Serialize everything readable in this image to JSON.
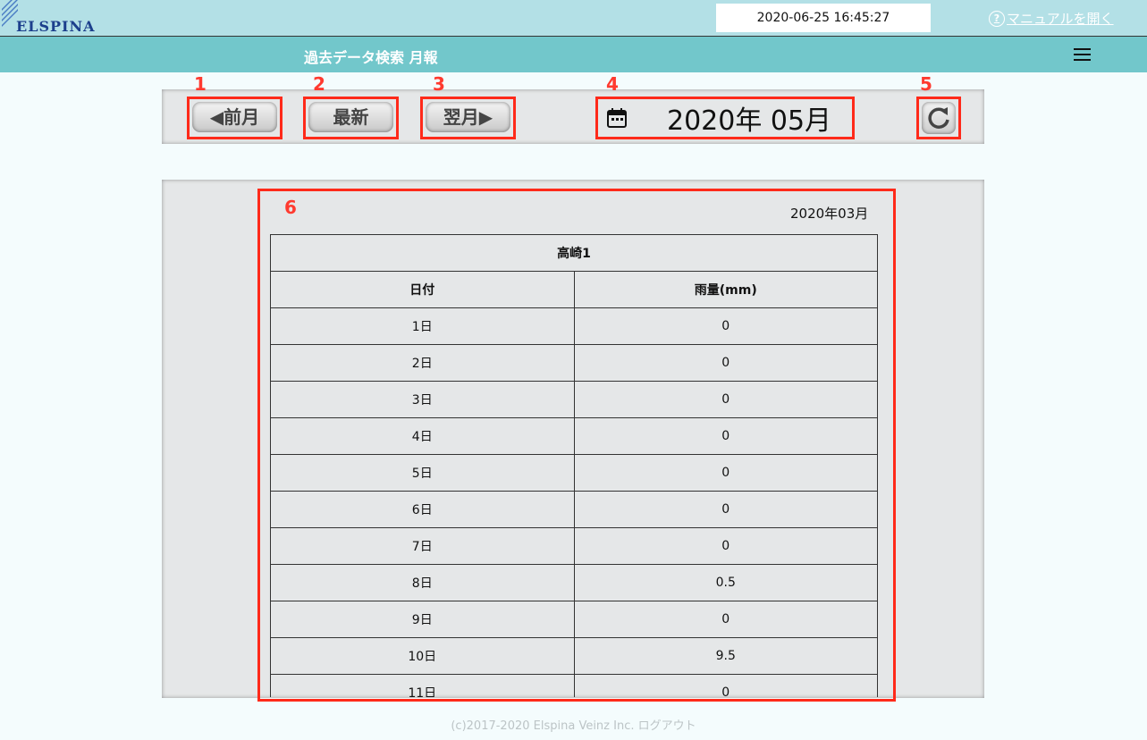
{
  "header": {
    "logo_text": "ELSPINA",
    "datetime": "2020-06-25 16:45:27",
    "manual_link": "マニュアルを開く",
    "help_icon": "?"
  },
  "titlebar": {
    "title": "過去データ検索 月報"
  },
  "toolbar": {
    "prev_label": "◀前月",
    "latest_label": "最新",
    "next_label": "翌月▶",
    "selected_month": "2020年 05月"
  },
  "annotations": {
    "labels": [
      "1",
      "2",
      "3",
      "4",
      "5",
      "6"
    ],
    "color": "#ff2a1a"
  },
  "report": {
    "month": "2020年03月",
    "station": "高崎1",
    "columns": [
      "日付",
      "雨量(mm)"
    ],
    "rows": [
      [
        "1日",
        "0"
      ],
      [
        "2日",
        "0"
      ],
      [
        "3日",
        "0"
      ],
      [
        "4日",
        "0"
      ],
      [
        "5日",
        "0"
      ],
      [
        "6日",
        "0"
      ],
      [
        "7日",
        "0"
      ],
      [
        "8日",
        "0.5"
      ],
      [
        "9日",
        "0"
      ],
      [
        "10日",
        "9.5"
      ],
      [
        "11日",
        "0"
      ]
    ]
  },
  "footer": {
    "text": "(c)2017-2020 Elspina Veinz Inc. ログアウト"
  },
  "colors": {
    "topbar": "#b3e0e6",
    "titlebar": "#72c7cb",
    "panel": "#e5e7e8",
    "logo": "#1c3f8c"
  }
}
